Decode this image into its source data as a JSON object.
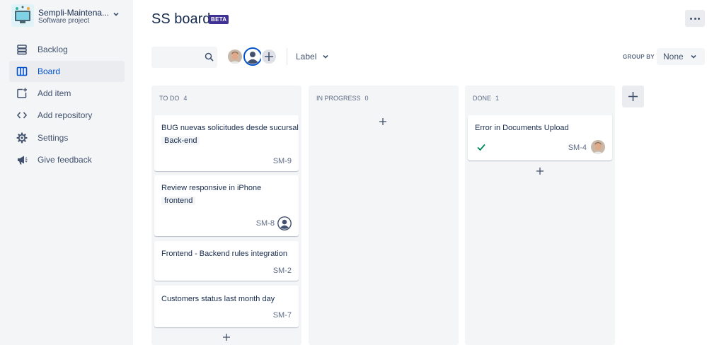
{
  "project": {
    "name": "Sempli-Maintena...",
    "type": "Software project"
  },
  "nav": [
    {
      "label": "Backlog",
      "icon": "backlog-icon"
    },
    {
      "label": "Board",
      "icon": "board-icon"
    },
    {
      "label": "Add item",
      "icon": "add-item-icon"
    },
    {
      "label": "Add repository",
      "icon": "code-icon"
    },
    {
      "label": "Settings",
      "icon": "gear-icon"
    },
    {
      "label": "Give feedback",
      "icon": "megaphone-icon"
    }
  ],
  "header": {
    "title": "SS board",
    "badge": "BETA"
  },
  "toolbar": {
    "search_value": "",
    "label_filter": "Label",
    "group_by_label": "GROUP BY",
    "group_by_value": "None"
  },
  "columns": [
    {
      "name": "TO DO",
      "count": "4",
      "cards": [
        {
          "title": "BUG nuevas solicitudes desde sucursal",
          "label": "Back-end",
          "key": "SM-9"
        },
        {
          "title": "Review responsive in iPhone",
          "label": "frontend",
          "key": "SM-8",
          "assignee": "default-user-avatar"
        },
        {
          "title": "Frontend - Backend rules integration",
          "key": "SM-2"
        },
        {
          "title": "Customers status last month day",
          "key": "SM-7"
        }
      ]
    },
    {
      "name": "IN PROGRESS",
      "count": "0",
      "cards": []
    },
    {
      "name": "DONE",
      "count": "1",
      "cards": [
        {
          "title": "Error in Documents Upload",
          "key": "SM-4",
          "status": "done-check-icon",
          "assignee": "photo-avatar"
        }
      ]
    }
  ],
  "colors": {
    "accent": "#0052CC",
    "beta": "#403294",
    "done": "#00875A",
    "sidebar": "#F4F5F7"
  }
}
